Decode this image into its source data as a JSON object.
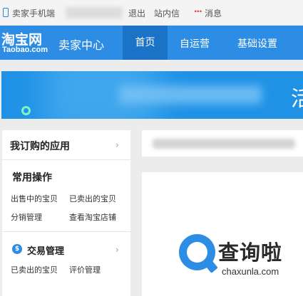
{
  "topbar": {
    "mobile_link": "卖家手机端",
    "logout": "退出",
    "message_center": "站内信",
    "messages": "消息"
  },
  "header": {
    "logo_main": "淘宝网",
    "logo_sub": "Taobao.com",
    "app_title": "卖家中心",
    "nav": [
      "首页",
      "自运营",
      "基础设置"
    ],
    "active_nav": "首页",
    "color": "#2d8de4"
  },
  "banner": {
    "visible_char": "活"
  },
  "sidebar": {
    "apps_title": "我订购的应用",
    "common_ops_title": "常用操作",
    "common_ops": [
      "出售中的宝贝",
      "已卖出的宝贝",
      "分销管理",
      "查看淘宝店铺"
    ],
    "trade_title": "交易管理",
    "trade_links": [
      "已卖出的宝贝",
      "评价管理"
    ]
  },
  "watermark": {
    "name": "查询啦",
    "domain": "chaxunla.com"
  }
}
